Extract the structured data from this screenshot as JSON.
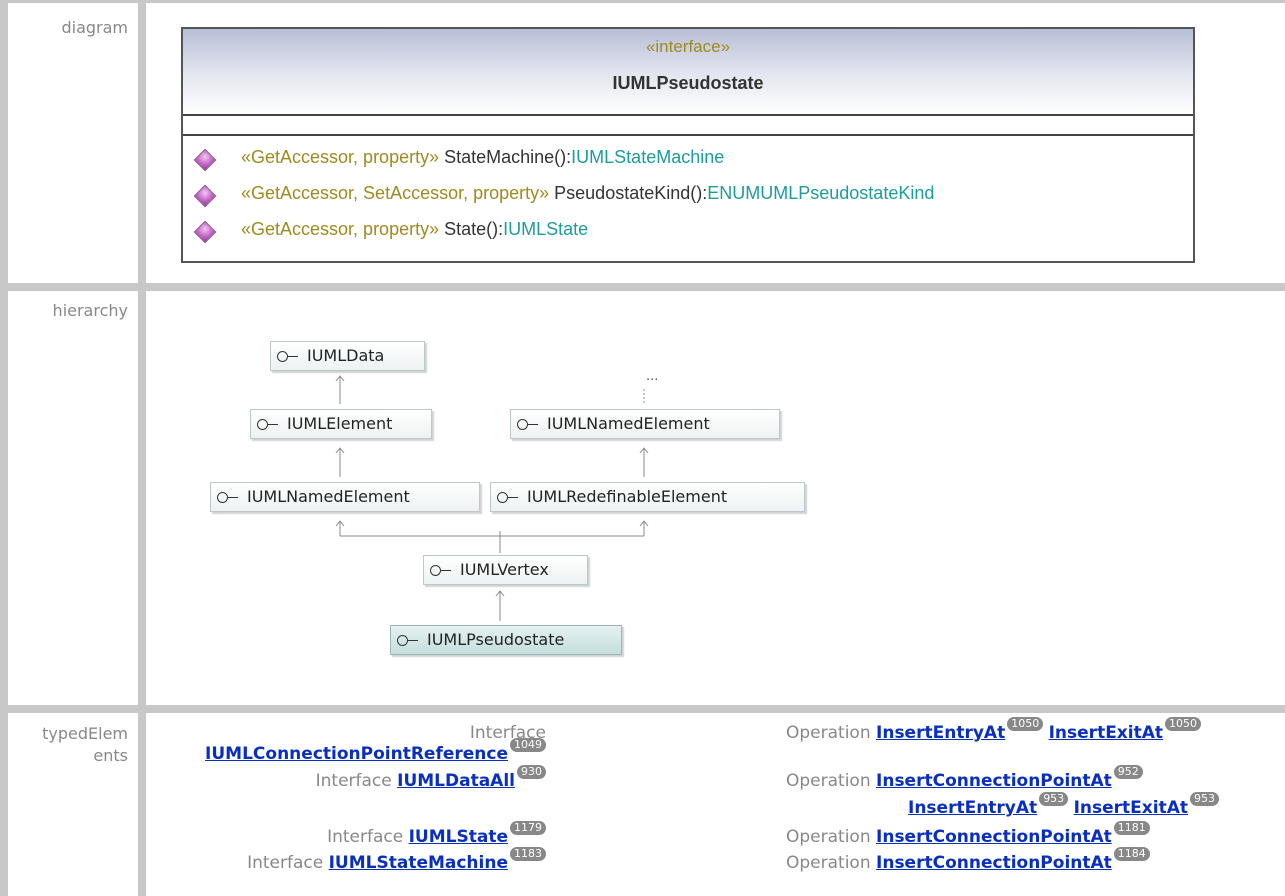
{
  "rows": {
    "diagram": "diagram",
    "hierarchy": "hierarchy",
    "typed_elements_1": "typedElem",
    "typed_elements_2": "ents"
  },
  "diagram": {
    "stereotype": "«interface»",
    "name": "IUMLPseudostate",
    "operations": [
      {
        "stereo": "«GetAccessor, property»",
        "name": " StateMachine():",
        "type": "IUMLStateMachine"
      },
      {
        "stereo": "«GetAccessor, SetAccessor, property»",
        "name": " PseudostateKind():",
        "type": "ENUMUMLPseudostateKind"
      },
      {
        "stereo": "«GetAccessor, property»",
        "name": " State():",
        "type": "IUMLState"
      }
    ]
  },
  "hierarchy": {
    "nodes": {
      "data": "IUMLData",
      "element": "IUMLElement",
      "named_top": "IUMLNamedElement",
      "named_left": "IUMLNamedElement",
      "redefinable": "IUMLRedefinableElement",
      "vertex": "IUMLVertex",
      "pseudostate": "IUMLPseudostate"
    },
    "ellipsis": "..."
  },
  "typed_elements": {
    "left": [
      {
        "kind": "Interface",
        "name": "",
        "badge": ""
      },
      {
        "kind": "",
        "name": "IUMLConnectionPointReference",
        "badge": "1049"
      },
      {
        "kind": "Interface ",
        "name": "IUMLDataAll",
        "badge": "930"
      },
      {
        "kind": "Interface ",
        "name": "IUMLState",
        "badge": "1179"
      },
      {
        "kind": "Interface ",
        "name": "IUMLStateMachine",
        "badge": "1183"
      }
    ],
    "right": [
      {
        "kind": "Operation ",
        "links": [
          {
            "name": "InsertEntryAt",
            "badge": "1050"
          },
          {
            "name": "InsertExitAt",
            "badge": "1050"
          }
        ]
      },
      {
        "kind": "Operation ",
        "links": [
          {
            "name": "InsertConnectionPointAt",
            "badge": "952"
          }
        ]
      },
      {
        "kind": "",
        "links": [
          {
            "name": "InsertEntryAt",
            "badge": "953"
          },
          {
            "name": "InsertExitAt",
            "badge": "953"
          }
        ]
      },
      {
        "kind": "Operation ",
        "links": [
          {
            "name": "InsertConnectionPointAt",
            "badge": "1181"
          }
        ]
      },
      {
        "kind": "Operation ",
        "links": [
          {
            "name": "InsertConnectionPointAt",
            "badge": "1184"
          }
        ]
      }
    ]
  }
}
